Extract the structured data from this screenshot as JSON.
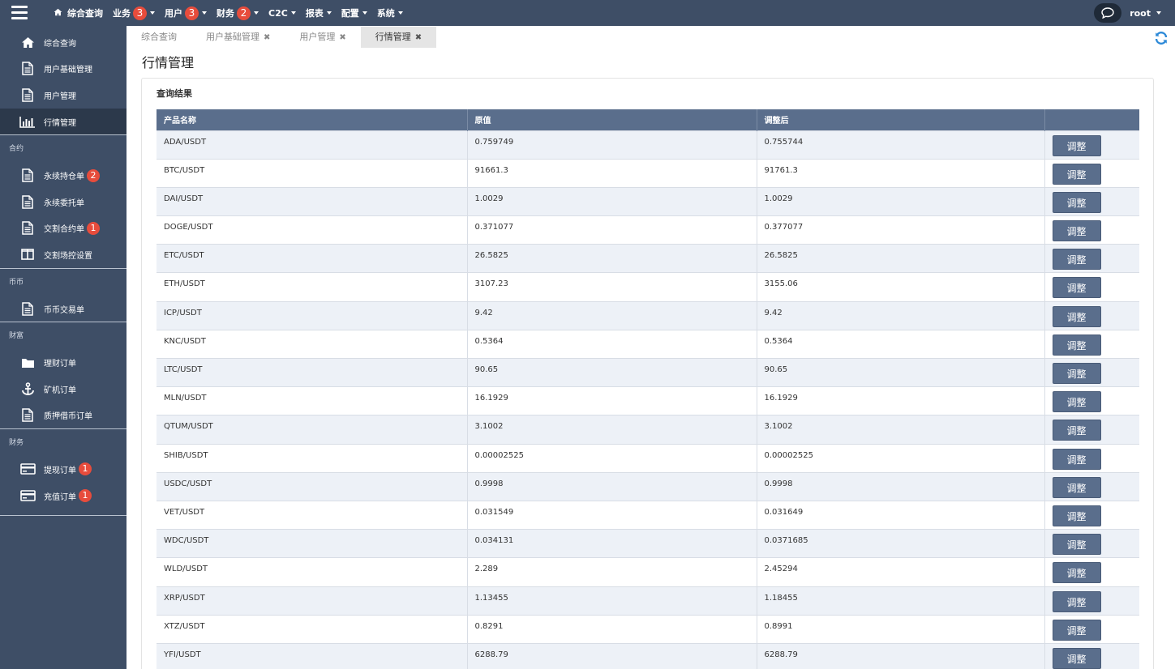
{
  "topbar": {
    "nav": [
      {
        "label": "综合查询",
        "badge": null,
        "has_caret": false
      },
      {
        "label": "业务",
        "badge": "3",
        "has_caret": true
      },
      {
        "label": "用户",
        "badge": "3",
        "has_caret": true
      },
      {
        "label": "财务",
        "badge": "2",
        "has_caret": true
      },
      {
        "label": "C2C",
        "badge": null,
        "has_caret": true
      },
      {
        "label": "报表",
        "badge": null,
        "has_caret": true
      },
      {
        "label": "配置",
        "badge": null,
        "has_caret": true
      },
      {
        "label": "系统",
        "badge": null,
        "has_caret": true
      }
    ],
    "user": "root"
  },
  "sidebar": {
    "items_top": [
      {
        "label": "综合查询",
        "icon": "home-icon"
      },
      {
        "label": "用户基础管理",
        "icon": "document-icon"
      },
      {
        "label": "用户管理",
        "icon": "document-icon"
      },
      {
        "label": "行情管理",
        "icon": "bar-chart-icon",
        "active": true
      }
    ],
    "groups": [
      {
        "title": "合约",
        "items": [
          {
            "label": "永续持仓单",
            "icon": "document-icon",
            "badge": "2"
          },
          {
            "label": "永续委托单",
            "icon": "document-icon"
          },
          {
            "label": "交割合约单",
            "icon": "document-icon",
            "badge": "1"
          },
          {
            "label": "交割场控设置",
            "icon": "columns-icon"
          }
        ]
      },
      {
        "title": "币币",
        "items": [
          {
            "label": "币币交易单",
            "icon": "document-icon"
          }
        ]
      },
      {
        "title": "财富",
        "items": [
          {
            "label": "理财订单",
            "icon": "folder-icon"
          },
          {
            "label": "矿机订单",
            "icon": "anchor-icon"
          },
          {
            "label": "质押借币订单",
            "icon": "document-icon"
          }
        ]
      },
      {
        "title": "财务",
        "items": [
          {
            "label": "提现订单",
            "icon": "credit-card-icon",
            "badge": "1"
          },
          {
            "label": "充值订单",
            "icon": "credit-card-icon",
            "badge": "1"
          }
        ]
      }
    ]
  },
  "tabs": [
    {
      "label": "综合查询",
      "closable": false,
      "active": false
    },
    {
      "label": "用户基础管理",
      "closable": true,
      "active": false
    },
    {
      "label": "用户管理",
      "closable": true,
      "active": false
    },
    {
      "label": "行情管理",
      "closable": true,
      "active": true
    }
  ],
  "page_title": "行情管理",
  "panel_title": "查询结果",
  "table": {
    "headers": [
      "产品名称",
      "原值",
      "调整后",
      ""
    ],
    "button_label": "调整",
    "rows": [
      [
        "ADA/USDT",
        "0.759749",
        "0.755744"
      ],
      [
        "BTC/USDT",
        "91661.3",
        "91761.3"
      ],
      [
        "DAI/USDT",
        "1.0029",
        "1.0029"
      ],
      [
        "DOGE/USDT",
        "0.371077",
        "0.377077"
      ],
      [
        "ETC/USDT",
        "26.5825",
        "26.5825"
      ],
      [
        "ETH/USDT",
        "3107.23",
        "3155.06"
      ],
      [
        "ICP/USDT",
        "9.42",
        "9.42"
      ],
      [
        "KNC/USDT",
        "0.5364",
        "0.5364"
      ],
      [
        "LTC/USDT",
        "90.65",
        "90.65"
      ],
      [
        "MLN/USDT",
        "16.1929",
        "16.1929"
      ],
      [
        "QTUM/USDT",
        "3.1002",
        "3.1002"
      ],
      [
        "SHIB/USDT",
        "0.00002525",
        "0.00002525"
      ],
      [
        "USDC/USDT",
        "0.9998",
        "0.9998"
      ],
      [
        "VET/USDT",
        "0.031549",
        "0.031649"
      ],
      [
        "WDC/USDT",
        "0.034131",
        "0.0371685"
      ],
      [
        "WLD/USDT",
        "2.289",
        "2.45294"
      ],
      [
        "XRP/USDT",
        "1.13455",
        "1.18455"
      ],
      [
        "XTZ/USDT",
        "0.8291",
        "0.8991"
      ],
      [
        "YFI/USDT",
        "6288.79",
        "6288.79"
      ]
    ]
  },
  "colors": {
    "chrome": "#3e4e66",
    "header": "#5a6e8c",
    "badge": "#e74c3c",
    "accent": "#2e8ad8"
  }
}
